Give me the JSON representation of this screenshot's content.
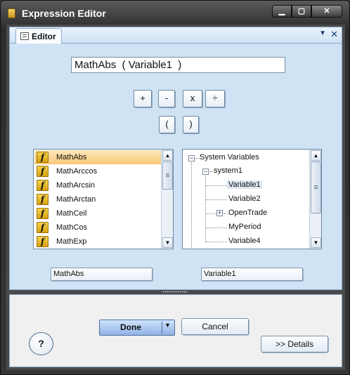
{
  "window": {
    "title": "Expression Editor",
    "minimize": "▁",
    "maximize": "▢",
    "close": "✕"
  },
  "tab": {
    "label": "Editor",
    "menu_glyph": "▼",
    "close_glyph": "✕"
  },
  "expression": "MathAbs  ( Variable1  )",
  "operators": [
    "+",
    "-",
    "x",
    "÷",
    "(",
    ")"
  ],
  "functions": {
    "items": [
      "MathAbs",
      "MathArccos",
      "MathArcsin",
      "MathArctan",
      "MathCeil",
      "MathCos",
      "MathExp"
    ],
    "icon_glyph": "f",
    "selected_index": 0
  },
  "variables_tree": {
    "root": "System Variables",
    "group": "system1",
    "items": [
      "Variable1",
      "Variable2",
      "OpenTrade",
      "MyPeriod",
      "Variable4"
    ],
    "selected": "Variable1",
    "expandable": "OpenTrade"
  },
  "selected_function": "MathAbs",
  "selected_variable": "Variable1",
  "scroll": {
    "up": "▲",
    "down": "▼"
  },
  "buttons": {
    "done": "Done",
    "done_arrow": "▼",
    "cancel": "Cancel",
    "details": ">> Details",
    "help": "?"
  },
  "colors": {
    "pane": "#cfe3f5",
    "selection": "#f7c978",
    "done": "#8fb3e6"
  }
}
